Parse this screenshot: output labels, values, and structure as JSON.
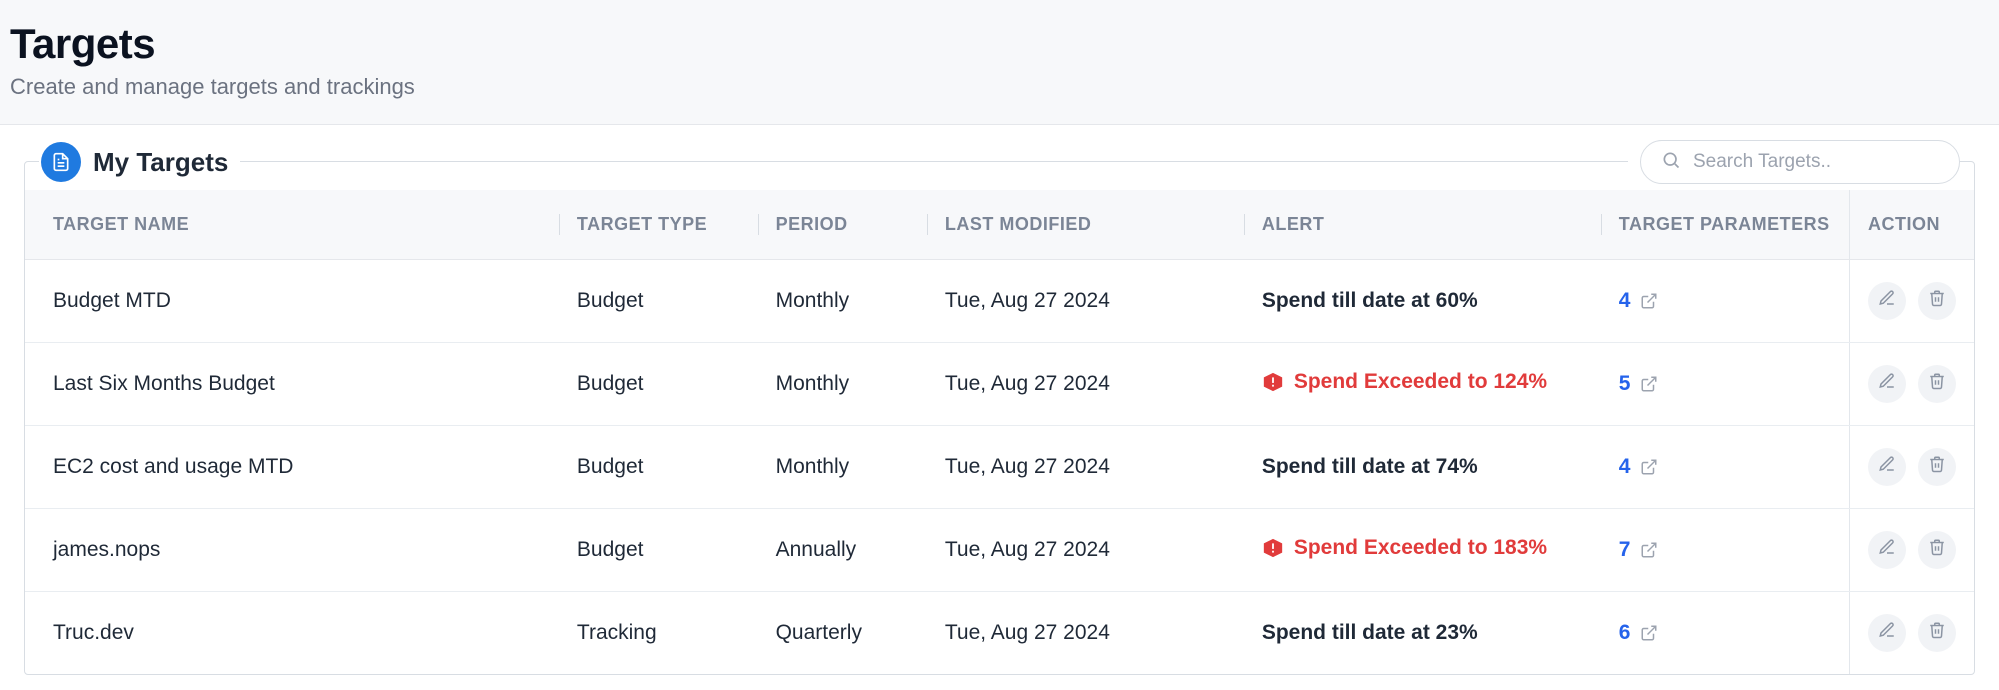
{
  "header": {
    "title": "Targets",
    "subtitle": "Create and manage targets and trackings"
  },
  "panel": {
    "title": "My Targets",
    "search_placeholder": "Search Targets.."
  },
  "columns": {
    "name": "TARGET NAME",
    "type": "TARGET TYPE",
    "period": "PERIOD",
    "modified": "LAST MODIFIED",
    "alert": "ALERT",
    "params": "TARGET PARAMETERS",
    "action": "ACTION"
  },
  "rows": [
    {
      "name": "Budget MTD",
      "type": "Budget",
      "period": "Monthly",
      "modified": "Tue, Aug 27 2024",
      "alert": "Spend till date at 60%",
      "alert_level": "normal",
      "params": "4"
    },
    {
      "name": "Last Six Months Budget",
      "type": "Budget",
      "period": "Monthly",
      "modified": "Tue, Aug 27 2024",
      "alert": "Spend Exceeded to 124%",
      "alert_level": "danger",
      "params": "5"
    },
    {
      "name": "EC2 cost and usage MTD",
      "type": "Budget",
      "period": "Monthly",
      "modified": "Tue, Aug 27 2024",
      "alert": "Spend till date at 74%",
      "alert_level": "normal",
      "params": "4"
    },
    {
      "name": "james.nops",
      "type": "Budget",
      "period": "Annually",
      "modified": "Tue, Aug 27 2024",
      "alert": "Spend Exceeded to 183%",
      "alert_level": "danger",
      "params": "7"
    },
    {
      "name": "Truc.dev",
      "type": "Tracking",
      "period": "Quarterly",
      "modified": "Tue, Aug 27 2024",
      "alert": "Spend till date at 23%",
      "alert_level": "normal",
      "params": "6"
    }
  ]
}
